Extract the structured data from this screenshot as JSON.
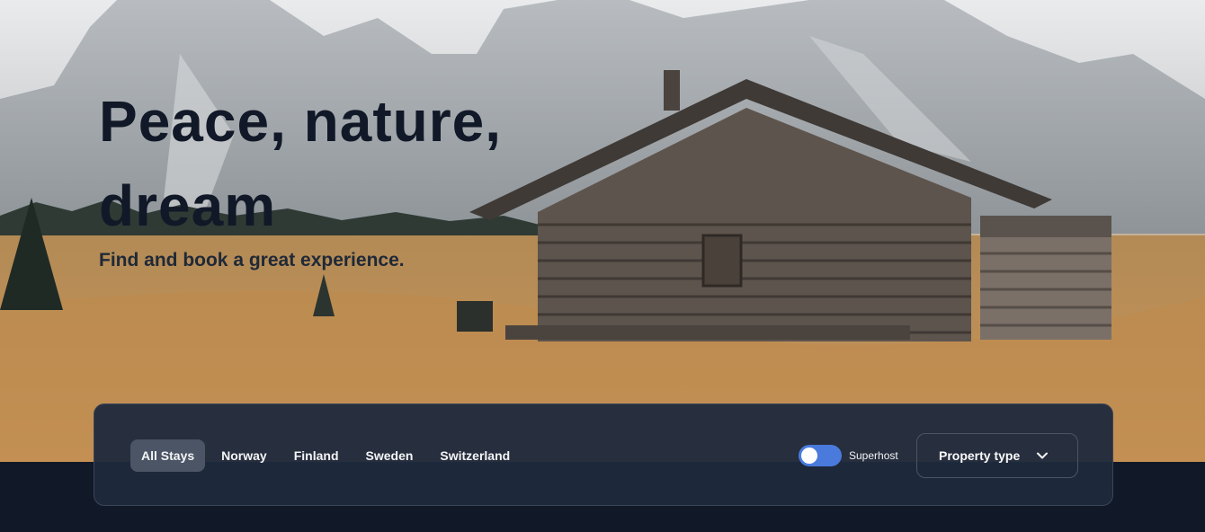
{
  "hero": {
    "title": "Peace, nature, dream",
    "subtitle": "Find and book a great experience."
  },
  "filters": {
    "tabs": [
      {
        "label": "All Stays",
        "active": true
      },
      {
        "label": "Norway",
        "active": false
      },
      {
        "label": "Finland",
        "active": false
      },
      {
        "label": "Sweden",
        "active": false
      },
      {
        "label": "Switzerland",
        "active": false
      }
    ],
    "superhost": {
      "label": "Superhost",
      "enabled": true
    },
    "property_type": {
      "label": "Property type",
      "icon": "chevron-down-icon"
    }
  },
  "colors": {
    "background": "#111827",
    "panel": "#1f293c",
    "toggle_on": "#4a7bdc",
    "active_tab": "#4b5565"
  }
}
